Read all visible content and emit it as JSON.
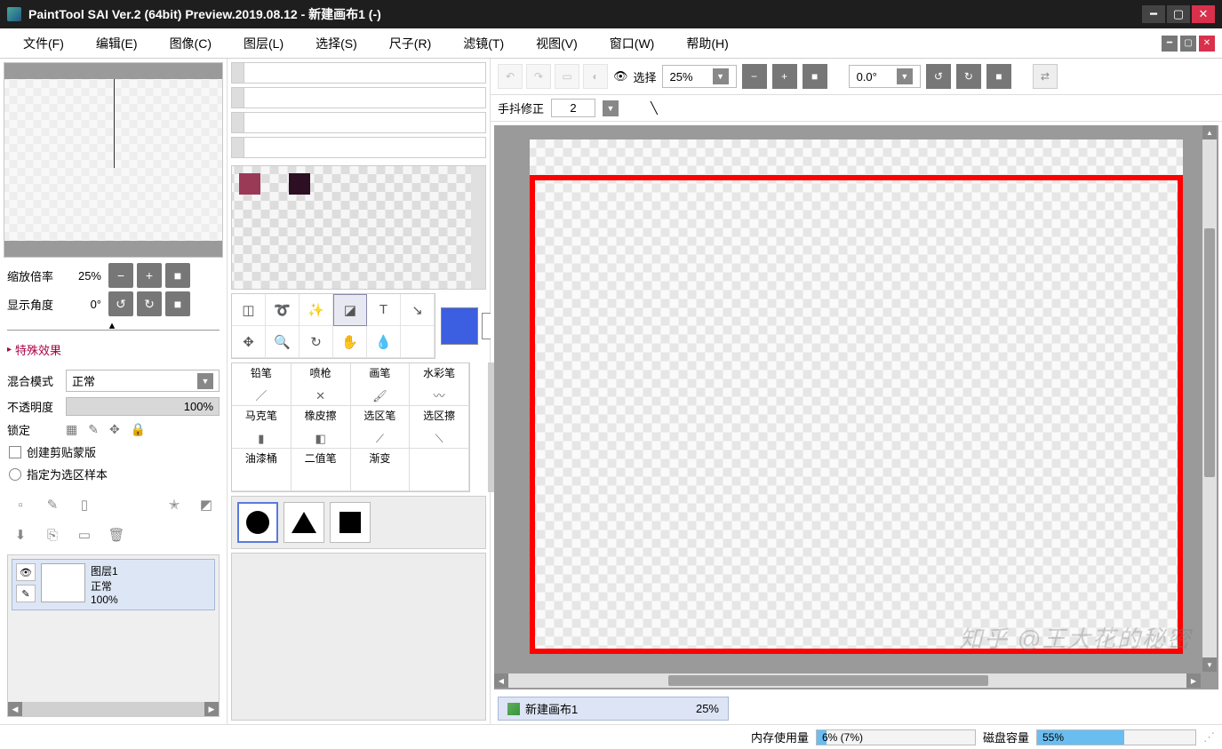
{
  "window": {
    "title": "PaintTool SAI Ver.2 (64bit) Preview.2019.08.12 - 新建画布1 (-)"
  },
  "menubar": {
    "file": "文件(F)",
    "edit": "编辑(E)",
    "image": "图像(C)",
    "layer": "图层(L)",
    "select": "选择(S)",
    "ruler": "尺子(R)",
    "filter": "滤镜(T)",
    "view": "视图(V)",
    "window": "窗口(W)",
    "help": "帮助(H)"
  },
  "navigator": {
    "zoom_label": "缩放倍率",
    "zoom_value": "25%",
    "angle_label": "显示角度",
    "angle_value": "0°"
  },
  "effects_header": "特殊效果",
  "layer_props": {
    "blend_label": "混合模式",
    "blend_value": "正常",
    "opacity_label": "不透明度",
    "opacity_value": "100%",
    "lock_label": "锁定",
    "clip_mask": "创建剪贴蒙版",
    "selection_source": "指定为选区样本"
  },
  "layer": {
    "name": "图层1",
    "mode": "正常",
    "opacity": "100%"
  },
  "brushes": {
    "pencil": "铅笔",
    "airbrush": "喷枪",
    "brush": "画笔",
    "watercolor": "水彩笔",
    "marker": "马克笔",
    "eraser": "橡皮擦",
    "select_pen": "选区笔",
    "select_eraser": "选区擦",
    "bucket": "油漆桶",
    "binary": "二值笔",
    "gradient": "渐变"
  },
  "top_toolbar": {
    "select_label": "选择",
    "zoom": "25%",
    "rotation": "0.0°"
  },
  "stabilizer": {
    "label": "手抖修正",
    "value": "2"
  },
  "document": {
    "name": "新建画布1",
    "zoom": "25%"
  },
  "statusbar": {
    "memory_label": "内存使用量",
    "memory_value": "6% (7%)",
    "memory_fill_pct": 6,
    "disk_label": "磁盘容量",
    "disk_value": "55%",
    "disk_fill_pct": 55
  },
  "watermark": "知乎 @王大花的秘密",
  "colors": {
    "swatch1": "#9a3a56",
    "swatch2": "#2c0f23",
    "foreground": "#3b5fe0"
  }
}
